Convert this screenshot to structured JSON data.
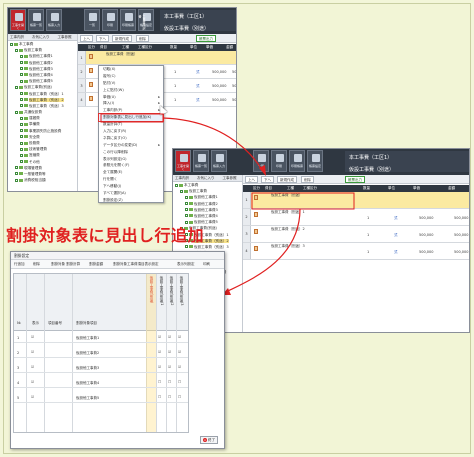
{
  "toolbar": {
    "buttons": [
      "工事を開く",
      "帳票一覧",
      "帳票入力",
      "一覧",
      "印刷",
      "印刷帳票",
      "帳票設定"
    ]
  },
  "project": {
    "category_label": "工事費内訳書",
    "name": "本工事費（工区1）",
    "sub": "仮設工事費（別途）"
  },
  "tree": {
    "header": [
      "工事内訳",
      "お気に入り",
      "工事参照"
    ],
    "nodes": [
      {
        "text": "本工事費",
        "level": 0,
        "sel": false
      },
      {
        "text": "仮設工事費",
        "level": 1,
        "sel": false
      },
      {
        "text": "仮設他工事費1",
        "level": 2,
        "sel": false
      },
      {
        "text": "仮設他工事費2",
        "level": 2,
        "sel": false
      },
      {
        "text": "仮設他工事費3",
        "level": 2,
        "sel": false
      },
      {
        "text": "仮設他工事費4",
        "level": 2,
        "sel": false
      },
      {
        "text": "仮設他工事費5",
        "level": 2,
        "sel": false
      },
      {
        "text": "仮設工事費(別途)",
        "level": 1,
        "sel": false
      },
      {
        "text": "仮設工事費（別途）1",
        "level": 2,
        "sel": false
      },
      {
        "text": "仮設工事費（別途）2",
        "level": 2,
        "sel": true
      },
      {
        "text": "仮設工事費（別途）3",
        "level": 2,
        "sel": false
      },
      {
        "text": "共通仮設費",
        "level": 1,
        "sel": false
      },
      {
        "text": "運搬費",
        "level": 2,
        "sel": false
      },
      {
        "text": "準備費",
        "level": 2,
        "sel": false
      },
      {
        "text": "事業損失防止施設費",
        "level": 2,
        "sel": false
      },
      {
        "text": "安全費",
        "level": 2,
        "sel": false
      },
      {
        "text": "役務費",
        "level": 2,
        "sel": false
      },
      {
        "text": "技術管理費",
        "level": 2,
        "sel": false
      },
      {
        "text": "営繕費",
        "level": 2,
        "sel": false
      },
      {
        "text": "その他",
        "level": 2,
        "sel": false
      },
      {
        "text": "現場管理費",
        "level": 1,
        "sel": false
      },
      {
        "text": "一般管理費等",
        "level": 1,
        "sel": false
      },
      {
        "text": "消費税相当額",
        "level": 1,
        "sel": false
      }
    ]
  },
  "subbar": {
    "buttons": [
      "上へ",
      "下へ",
      "新規作成",
      "削除",
      "帳票出力"
    ]
  },
  "grid": {
    "headers": [
      "区分",
      "費目",
      "工種",
      "工種区分",
      "数量",
      "単位",
      "単価",
      "金額"
    ],
    "rows": [
      {
        "n": "1",
        "name": "仮設工事費（別途）",
        "qty": "",
        "unit": "",
        "price": "",
        "amount": "",
        "hl": true
      },
      {
        "n": "2",
        "name": "仮設工事費（別途）1",
        "qty": "1",
        "unit": "式",
        "price": "500,000",
        "amount": "500,000",
        "hl": false
      },
      {
        "n": "3",
        "name": "仮設工事費（別途）2",
        "qty": "1",
        "unit": "式",
        "price": "500,000",
        "amount": "500,000",
        "hl": false
      },
      {
        "n": "4",
        "name": "仮設工事費（別途）3",
        "qty": "1",
        "unit": "式",
        "price": "500,000",
        "amount": "500,000",
        "hl": false
      }
    ]
  },
  "context_menu": {
    "items": [
      {
        "label": "切取(X)",
        "arrow": false
      },
      {
        "label": "複写(C)",
        "arrow": false
      },
      {
        "label": "貼付(V)",
        "arrow": false
      },
      {
        "label": "上に貼付(W)",
        "arrow": false
      },
      {
        "label": "単価(U)",
        "arrow": true
      },
      {
        "label": "挿入(I)",
        "arrow": true
      },
      {
        "label": "工事内訳(P)",
        "arrow": true
      },
      {
        "label": "割掛対象表に見出し行追加(K)",
        "arrow": false
      },
      {
        "label": "数量計算(T)",
        "arrow": false
      },
      {
        "label": "入力に戻す(R)",
        "arrow": false
      },
      {
        "label": "ネ算に戻す(O)",
        "arrow": false
      },
      {
        "label": "データ区分の変更(D)",
        "arrow": true
      },
      {
        "label": "この行以降削除",
        "arrow": false
      },
      {
        "label": "表示列設定(G)",
        "arrow": false
      },
      {
        "label": "参照元を開く(F)",
        "arrow": false
      },
      {
        "label": "全て展開(E)",
        "arrow": false
      },
      {
        "label": "行を開く",
        "arrow": false
      },
      {
        "label": "下へ移動(J)",
        "arrow": false
      },
      {
        "label": "すべて選択(A)",
        "arrow": false
      },
      {
        "label": "割掛設定(Z)",
        "arrow": false
      }
    ],
    "highlight_index": 7
  },
  "headline": "割掛対象表に見出し行追加",
  "dialog": {
    "title": "割掛設定",
    "toolbar": [
      "行追加",
      "削除",
      "割掛対象 割掛計算",
      "割掛金額",
      "割掛対象工事費項目表示設定",
      "表示列設定",
      "印刷"
    ],
    "col_headers": {
      "no": "№",
      "show": "表示",
      "item_no": "項目番号",
      "target": "割掛対象項目"
    },
    "vertical_headers": [
      "仮設工事費(別途)",
      "仮設工事費(別途)1",
      "仮設工事費(別途)2",
      "仮設工事費(別途)3"
    ],
    "rows": [
      {
        "n": "1",
        "show": "☑",
        "name": "仮設他工事費1",
        "checks": [
          "",
          "☑",
          "☑",
          "☑"
        ]
      },
      {
        "n": "2",
        "show": "☑",
        "name": "仮設他工事費2",
        "checks": [
          "",
          "☑",
          "☑",
          "☑"
        ]
      },
      {
        "n": "3",
        "show": "☑",
        "name": "仮設他工事費3",
        "checks": [
          "",
          "☑",
          "☑",
          "☑"
        ]
      },
      {
        "n": "4",
        "show": "☑",
        "name": "仮設他工事費4",
        "checks": [
          "",
          "☐",
          "☐",
          "☐"
        ]
      },
      {
        "n": "5",
        "show": "☑",
        "name": "仮設他工事費5",
        "checks": [
          "",
          "☐",
          "☐",
          "☐"
        ]
      }
    ],
    "close_label": "終了"
  },
  "colors": {
    "accent": "#e02020",
    "toolbar": "#2f3741",
    "highlight_row": "#fbeaa1",
    "tree_green": "#3b8a3b"
  }
}
